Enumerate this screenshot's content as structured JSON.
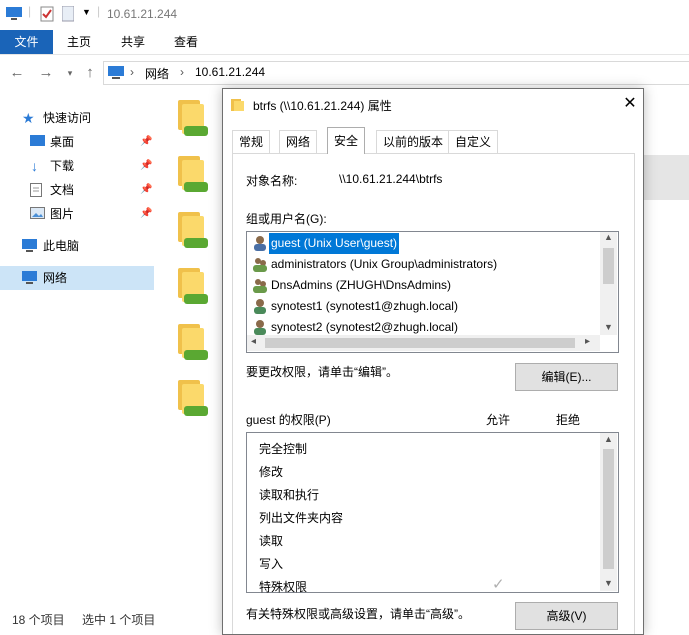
{
  "explorer": {
    "title": "10.61.21.244",
    "ribbon": {
      "file": "文件",
      "home": "主页",
      "share": "共享",
      "view": "查看"
    },
    "breadcrumb": {
      "network": "网络",
      "host": "10.61.21.244"
    },
    "sidebar": {
      "quick_access": "快速访问",
      "items": [
        {
          "label": "桌面"
        },
        {
          "label": "下载"
        },
        {
          "label": "文档"
        },
        {
          "label": "图片"
        }
      ],
      "this_pc": "此电脑",
      "network": "网络"
    },
    "status": {
      "count": "18 个项目",
      "selected": "选中 1 个项目"
    }
  },
  "dialog": {
    "title": "btrfs (\\\\10.61.21.244) 属性",
    "tabs": [
      "常规",
      "网络",
      "安全",
      "以前的版本",
      "自定义"
    ],
    "object_name_label": "对象名称:",
    "object_name_value": "\\\\10.61.21.244\\btrfs",
    "group_label": "组或用户名(G):",
    "users": [
      "guest (Unix User\\guest)",
      "administrators (Unix Group\\administrators)",
      "DnsAdmins (ZHUGH\\DnsAdmins)",
      "synotest1 (synotest1@zhugh.local)",
      "synotest2 (synotest2@zhugh.local)"
    ],
    "edit_hint": "要更改权限，请单击“编辑”。",
    "edit_button": "编辑(E)...",
    "perm_label": "guest 的权限(P)",
    "allow": "允许",
    "deny": "拒绝",
    "permissions": [
      "完全控制",
      "修改",
      "读取和执行",
      "列出文件夹内容",
      "读取",
      "写入",
      "特殊权限"
    ],
    "special_allow_mark": "✓",
    "advanced_hint": "有关特殊权限或高级设置，请单击“高级”。",
    "advanced_button": "高级(V)"
  }
}
